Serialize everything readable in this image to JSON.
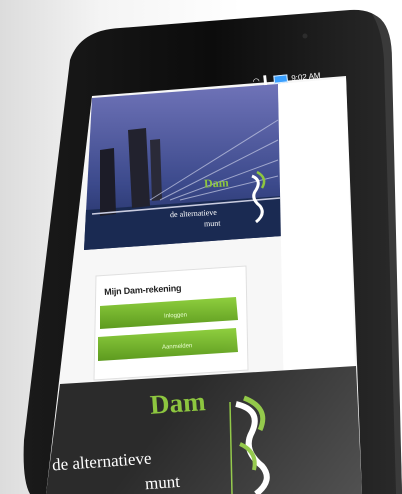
{
  "status_bar": {
    "wifi_icon": "wifi-icon",
    "signal_icon": "signal-icon",
    "battery_icon": "battery-icon",
    "time": "9:02 AM"
  },
  "banner": {
    "brand": "Dam",
    "tagline_line1": "de alternatieve",
    "tagline_line2": "munt"
  },
  "card": {
    "title": "Mijn Dam-rekening",
    "primary_button_label": "Inloggen",
    "secondary_button_label": "Aanmelden"
  },
  "footer": {
    "brand": "Dam",
    "tagline_line1": "de alternatieve",
    "tagline_line2": "munt"
  },
  "colors": {
    "brand_green": "#8dc63f",
    "button_green": "#6fae2b",
    "dark_panel": "#2b2b2b",
    "device_black": "#111111"
  }
}
